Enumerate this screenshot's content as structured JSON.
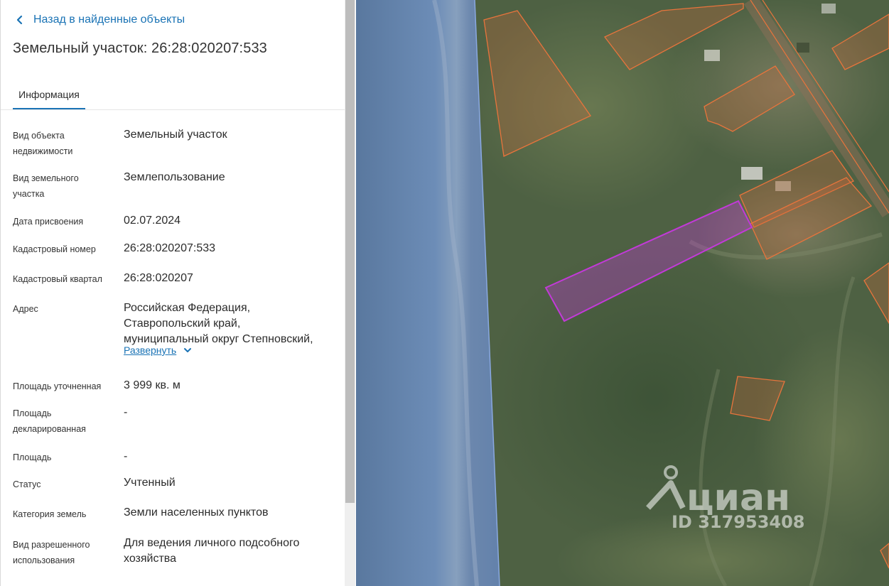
{
  "nav": {
    "back_label": "Назад в найденные объекты"
  },
  "title": "Земельный участок: 26:28:020207:533",
  "tabs": [
    {
      "label": "Информация",
      "active": true
    }
  ],
  "fields": {
    "object_type": {
      "label_l1": "Вид объекта",
      "label_l2": "недвижимости",
      "value": "Земельный участок"
    },
    "land_type": {
      "label_l1": "Вид земельного",
      "label_l2": "участка",
      "value": "Землепользование"
    },
    "assign_date": {
      "label": "Дата присвоения",
      "value": "02.07.2024"
    },
    "cadastral_number": {
      "label": "Кадастровый номер",
      "value": "26:28:020207:533"
    },
    "cadastral_quarter": {
      "label": "Кадастровый квартал",
      "value": "26:28:020207"
    },
    "address": {
      "label": "Адрес",
      "lines": [
        "Российская Федерация,",
        "Ставропольский край,",
        "муниципальный округ Степновский,"
      ],
      "expand_label": "Развернуть"
    },
    "area_refined": {
      "label": "Площадь уточненная",
      "value": "3 999 кв. м"
    },
    "area_declared": {
      "label_l1": "Площадь",
      "label_l2": "декларированная",
      "value": "-"
    },
    "area": {
      "label": "Площадь",
      "value": "-"
    },
    "status": {
      "label": "Статус",
      "value": "Учтенный"
    },
    "land_category": {
      "label": "Категория земель",
      "value": "Земли населенных пунктов"
    },
    "permitted_use": {
      "label_l1": "Вид разрешенного",
      "label_l2": "использования",
      "value_l1": "Для ведения личного подсобного",
      "value_l2": "хозяйства"
    }
  },
  "map": {
    "watermark_brand": "циан",
    "watermark_id": "ID 317953408",
    "colors": {
      "selected_parcel": "#c23ad8",
      "parcel_outline": "#e8743c",
      "water_zone": "#6f8fd0",
      "accent": "#1a73b5"
    }
  }
}
